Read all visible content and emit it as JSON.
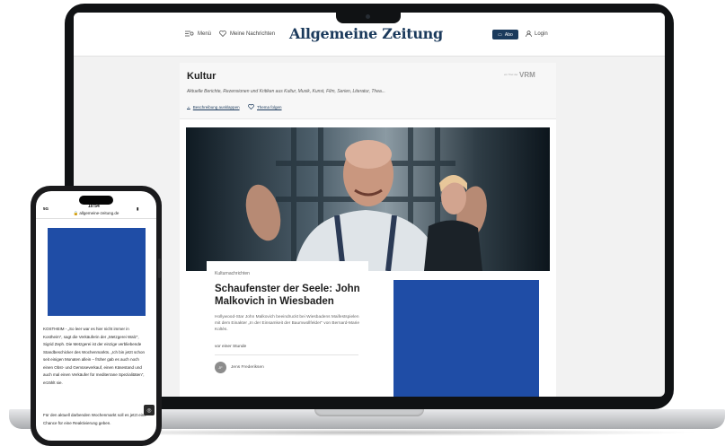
{
  "header": {
    "menu_label": "Menü",
    "saved_label": "Meine Nachrichten",
    "logo_text": "Allgemeine Zeitung",
    "abo_label": "Abo",
    "login_label": "Login",
    "brand_color": "#1b3a5c"
  },
  "topic": {
    "title": "Kultur",
    "description": "Aktuelle Berichte, Rezensionen und Kritiken aus Kultur, Musik, Kunst, Film, Serien, Literatur, Thea...",
    "expand_label": "Beschreibung ausklappen",
    "follow_label": "Thema folgen",
    "publisher_prefix": "ein Titel der",
    "publisher": "VRM"
  },
  "article": {
    "kicker": "Kulturnachrichten",
    "headline": "Schaufenster der Seele: John Malkovich in Wiesbaden",
    "summary": "Hollywood-Star John Malkovich beeindruckt bei Wiesbadens Maifestspielen mit dem Einakter „In der Einsamkeit der Baumwollfelder“ von Bernard-Marie Koltès.",
    "time": "vor einer Stunde",
    "author_initials": "JF",
    "author": "Jens Frederiksen"
  },
  "ad_color": "#1f4da6",
  "phone": {
    "status_left": "5G",
    "time": "10:54",
    "status_right": "▮",
    "url": "🔒 allgemeine-zeitung.de",
    "body_text": "KOSTHEIM - „So leer war es hier nicht immer in Kostheim“, sagt die Verkäuferin der „Metzgerei Walz“, Sigrid Zeph. Die Metzgerei ist der einzige verbliebende Standbeschicker des Wochenmarkts. „Ich bin jetzt schon seit einigen Monaten allein – früher gab es auch noch einen Obst- und Gemüseverkauf, einen Käsestand und auch mal einen Verkäufer für mediterrane Spezialitäten“, erzählt sie.",
    "body_text_2": "Für den aktuell darbenden Wochenmarkt soll es jetzt eine Chance für eine Reaktivierung geben."
  }
}
